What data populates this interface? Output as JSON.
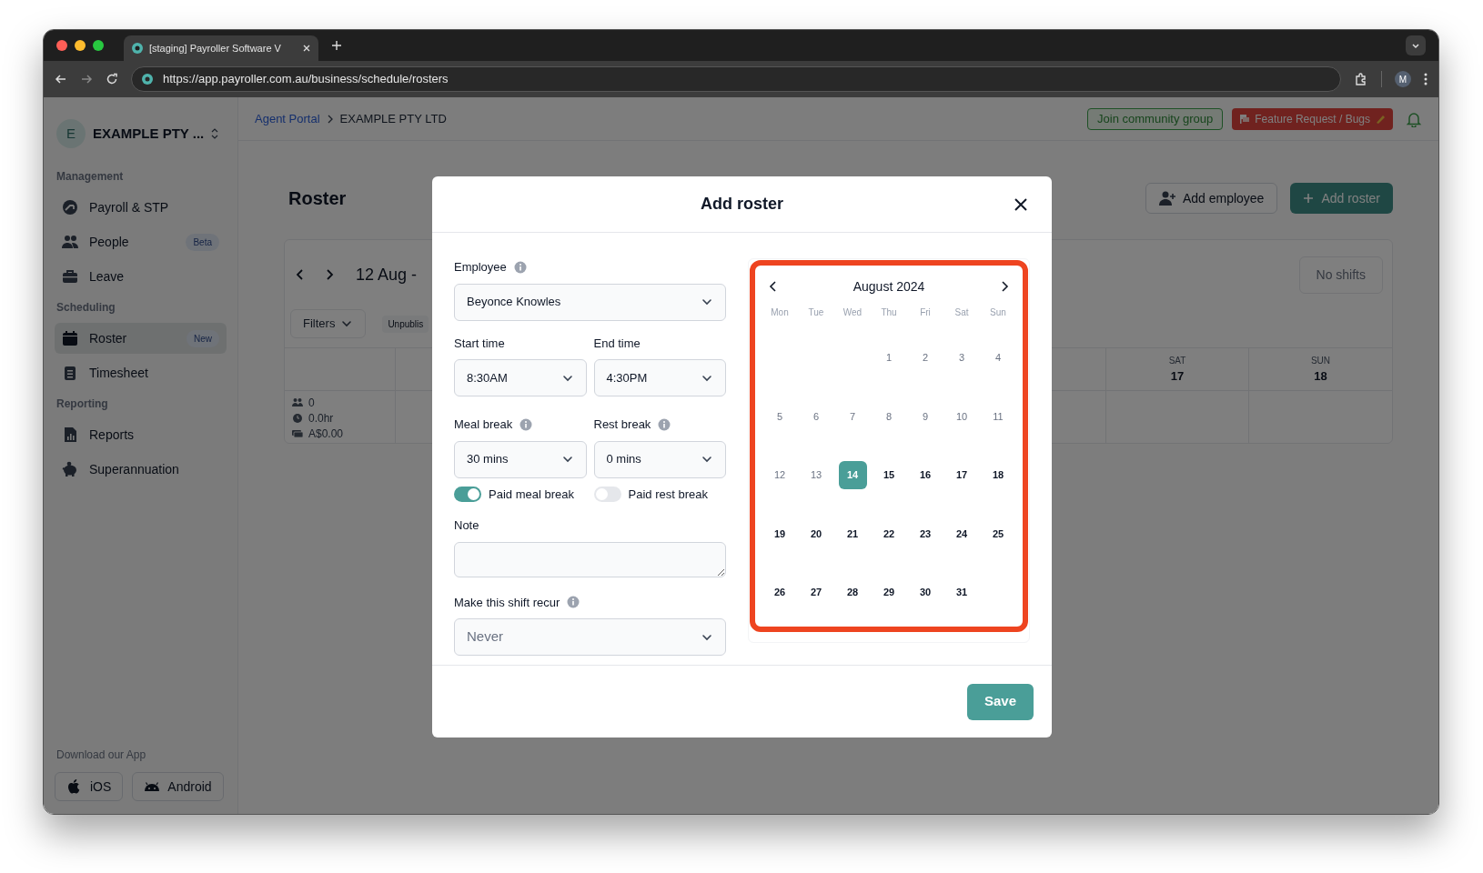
{
  "browser": {
    "tab_title": "[staging] Payroller Software V",
    "url": "https://app.payroller.com.au/business/schedule/rosters",
    "profile_initial": "M"
  },
  "sidebar": {
    "org_initial": "E",
    "org_name": "EXAMPLE PTY ...",
    "sections": [
      {
        "title": "Management",
        "items": [
          {
            "label": "Payroll & STP",
            "selected": false
          },
          {
            "label": "People",
            "badge": "Beta",
            "selected": false
          },
          {
            "label": "Leave",
            "selected": false
          }
        ]
      },
      {
        "title": "Scheduling",
        "items": [
          {
            "label": "Roster",
            "badge": "New",
            "selected": true
          },
          {
            "label": "Timesheet",
            "selected": false
          }
        ]
      },
      {
        "title": "Reporting",
        "items": [
          {
            "label": "Reports",
            "selected": false
          },
          {
            "label": "Superannuation",
            "selected": false
          }
        ]
      }
    ],
    "download": {
      "title": "Download our App",
      "buttons": [
        {
          "label": "iOS"
        },
        {
          "label": "Android"
        }
      ]
    }
  },
  "topbar": {
    "breadcrumbs": [
      {
        "label": "Agent Portal",
        "link": true
      },
      {
        "label": "EXAMPLE PTY LTD",
        "link": false
      }
    ],
    "community_button": "Join community group",
    "feedback_button": "Feature Request / Bugs"
  },
  "roster": {
    "title": "Roster",
    "actions": [
      {
        "label": "Add employee",
        "kind": "secondary"
      },
      {
        "label": "Add roster",
        "kind": "primary"
      }
    ],
    "range": "12 Aug -",
    "no_shifts": "No shifts",
    "filters": "Filters",
    "status_chip": "Unpublis",
    "days": [
      {
        "weekday": "SAT",
        "date": "17"
      },
      {
        "weekday": "SUN",
        "date": "18"
      }
    ],
    "summary": [
      "0",
      "0.0hr",
      "A$0.00"
    ]
  },
  "modal": {
    "title": "Add roster",
    "employee": {
      "label": "Employee",
      "info": true,
      "value": "Beyonce Knowles"
    },
    "start_time": {
      "label": "Start time",
      "info": false,
      "value": "8:30AM"
    },
    "end_time": {
      "label": "End time",
      "info": false,
      "value": "4:30PM"
    },
    "meal_break": {
      "label": "Meal break",
      "info": true,
      "value": "30 mins"
    },
    "rest_break": {
      "label": "Rest break",
      "info": true,
      "value": "0 mins"
    },
    "toggles": [
      {
        "label": "Paid meal break",
        "on": true
      },
      {
        "label": "Paid rest break",
        "on": false
      }
    ],
    "note": {
      "label": "Note"
    },
    "recur": {
      "label": "Make this shift recur",
      "info": true,
      "placeholder": "Never"
    },
    "calendar": {
      "month": "August 2024",
      "highlighted": true,
      "weekdays": [
        "Mon",
        "Tue",
        "Wed",
        "Thu",
        "Fri",
        "Sat",
        "Sun"
      ],
      "weeks": [
        {
          "days": [
            {
              "label": "1",
              "past": true,
              "selected": false
            },
            {
              "label": "2",
              "past": true,
              "selected": false
            },
            {
              "label": "3",
              "past": true,
              "selected": false
            },
            {
              "label": "4",
              "past": true,
              "selected": false
            }
          ]
        },
        {
          "days": [
            {
              "label": "5",
              "past": true,
              "selected": false
            },
            {
              "label": "6",
              "past": true,
              "selected": false
            },
            {
              "label": "7",
              "past": true,
              "selected": false
            },
            {
              "label": "8",
              "past": true,
              "selected": false
            },
            {
              "label": "9",
              "past": true,
              "selected": false
            },
            {
              "label": "10",
              "past": true,
              "selected": false
            },
            {
              "label": "11",
              "past": true,
              "selected": false
            }
          ]
        },
        {
          "days": [
            {
              "label": "12",
              "past": true,
              "selected": false
            },
            {
              "label": "13",
              "past": true,
              "selected": false
            },
            {
              "label": "14",
              "past": false,
              "selected": true
            },
            {
              "label": "15",
              "past": false,
              "selected": false
            },
            {
              "label": "16",
              "past": false,
              "selected": false
            },
            {
              "label": "17",
              "past": false,
              "selected": false
            },
            {
              "label": "18",
              "past": false,
              "selected": false
            }
          ]
        },
        {
          "days": [
            {
              "label": "19",
              "past": false,
              "selected": false
            },
            {
              "label": "20",
              "past": false,
              "selected": false
            },
            {
              "label": "21",
              "past": false,
              "selected": false
            },
            {
              "label": "22",
              "past": false,
              "selected": false
            },
            {
              "label": "23",
              "past": false,
              "selected": false
            },
            {
              "label": "24",
              "past": false,
              "selected": false
            },
            {
              "label": "25",
              "past": false,
              "selected": false
            }
          ]
        },
        {
          "days": [
            {
              "label": "26",
              "past": false,
              "selected": false
            },
            {
              "label": "27",
              "past": false,
              "selected": false
            },
            {
              "label": "28",
              "past": false,
              "selected": false
            },
            {
              "label": "29",
              "past": false,
              "selected": false
            },
            {
              "label": "30",
              "past": false,
              "selected": false
            },
            {
              "label": "31",
              "past": false,
              "selected": false
            }
          ]
        }
      ]
    },
    "save": "Save"
  }
}
